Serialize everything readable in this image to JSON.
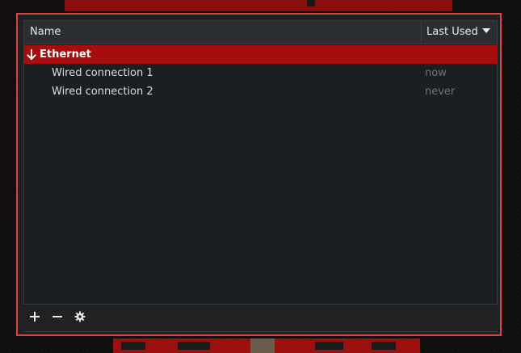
{
  "columns": {
    "name": "Name",
    "last_used": "Last Used"
  },
  "groups": [
    {
      "label": "Ethernet",
      "connections": [
        {
          "name": "Wired connection 1",
          "last_used": "now"
        },
        {
          "name": "Wired connection 2",
          "last_used": "never"
        }
      ]
    }
  ],
  "toolbar": {
    "add_icon": "plus-icon",
    "remove_icon": "minus-icon",
    "settings_icon": "gear-icon"
  },
  "colors": {
    "accent": "#a80d0d",
    "window_border": "#d9443f",
    "muted_text": "#6e7479"
  }
}
